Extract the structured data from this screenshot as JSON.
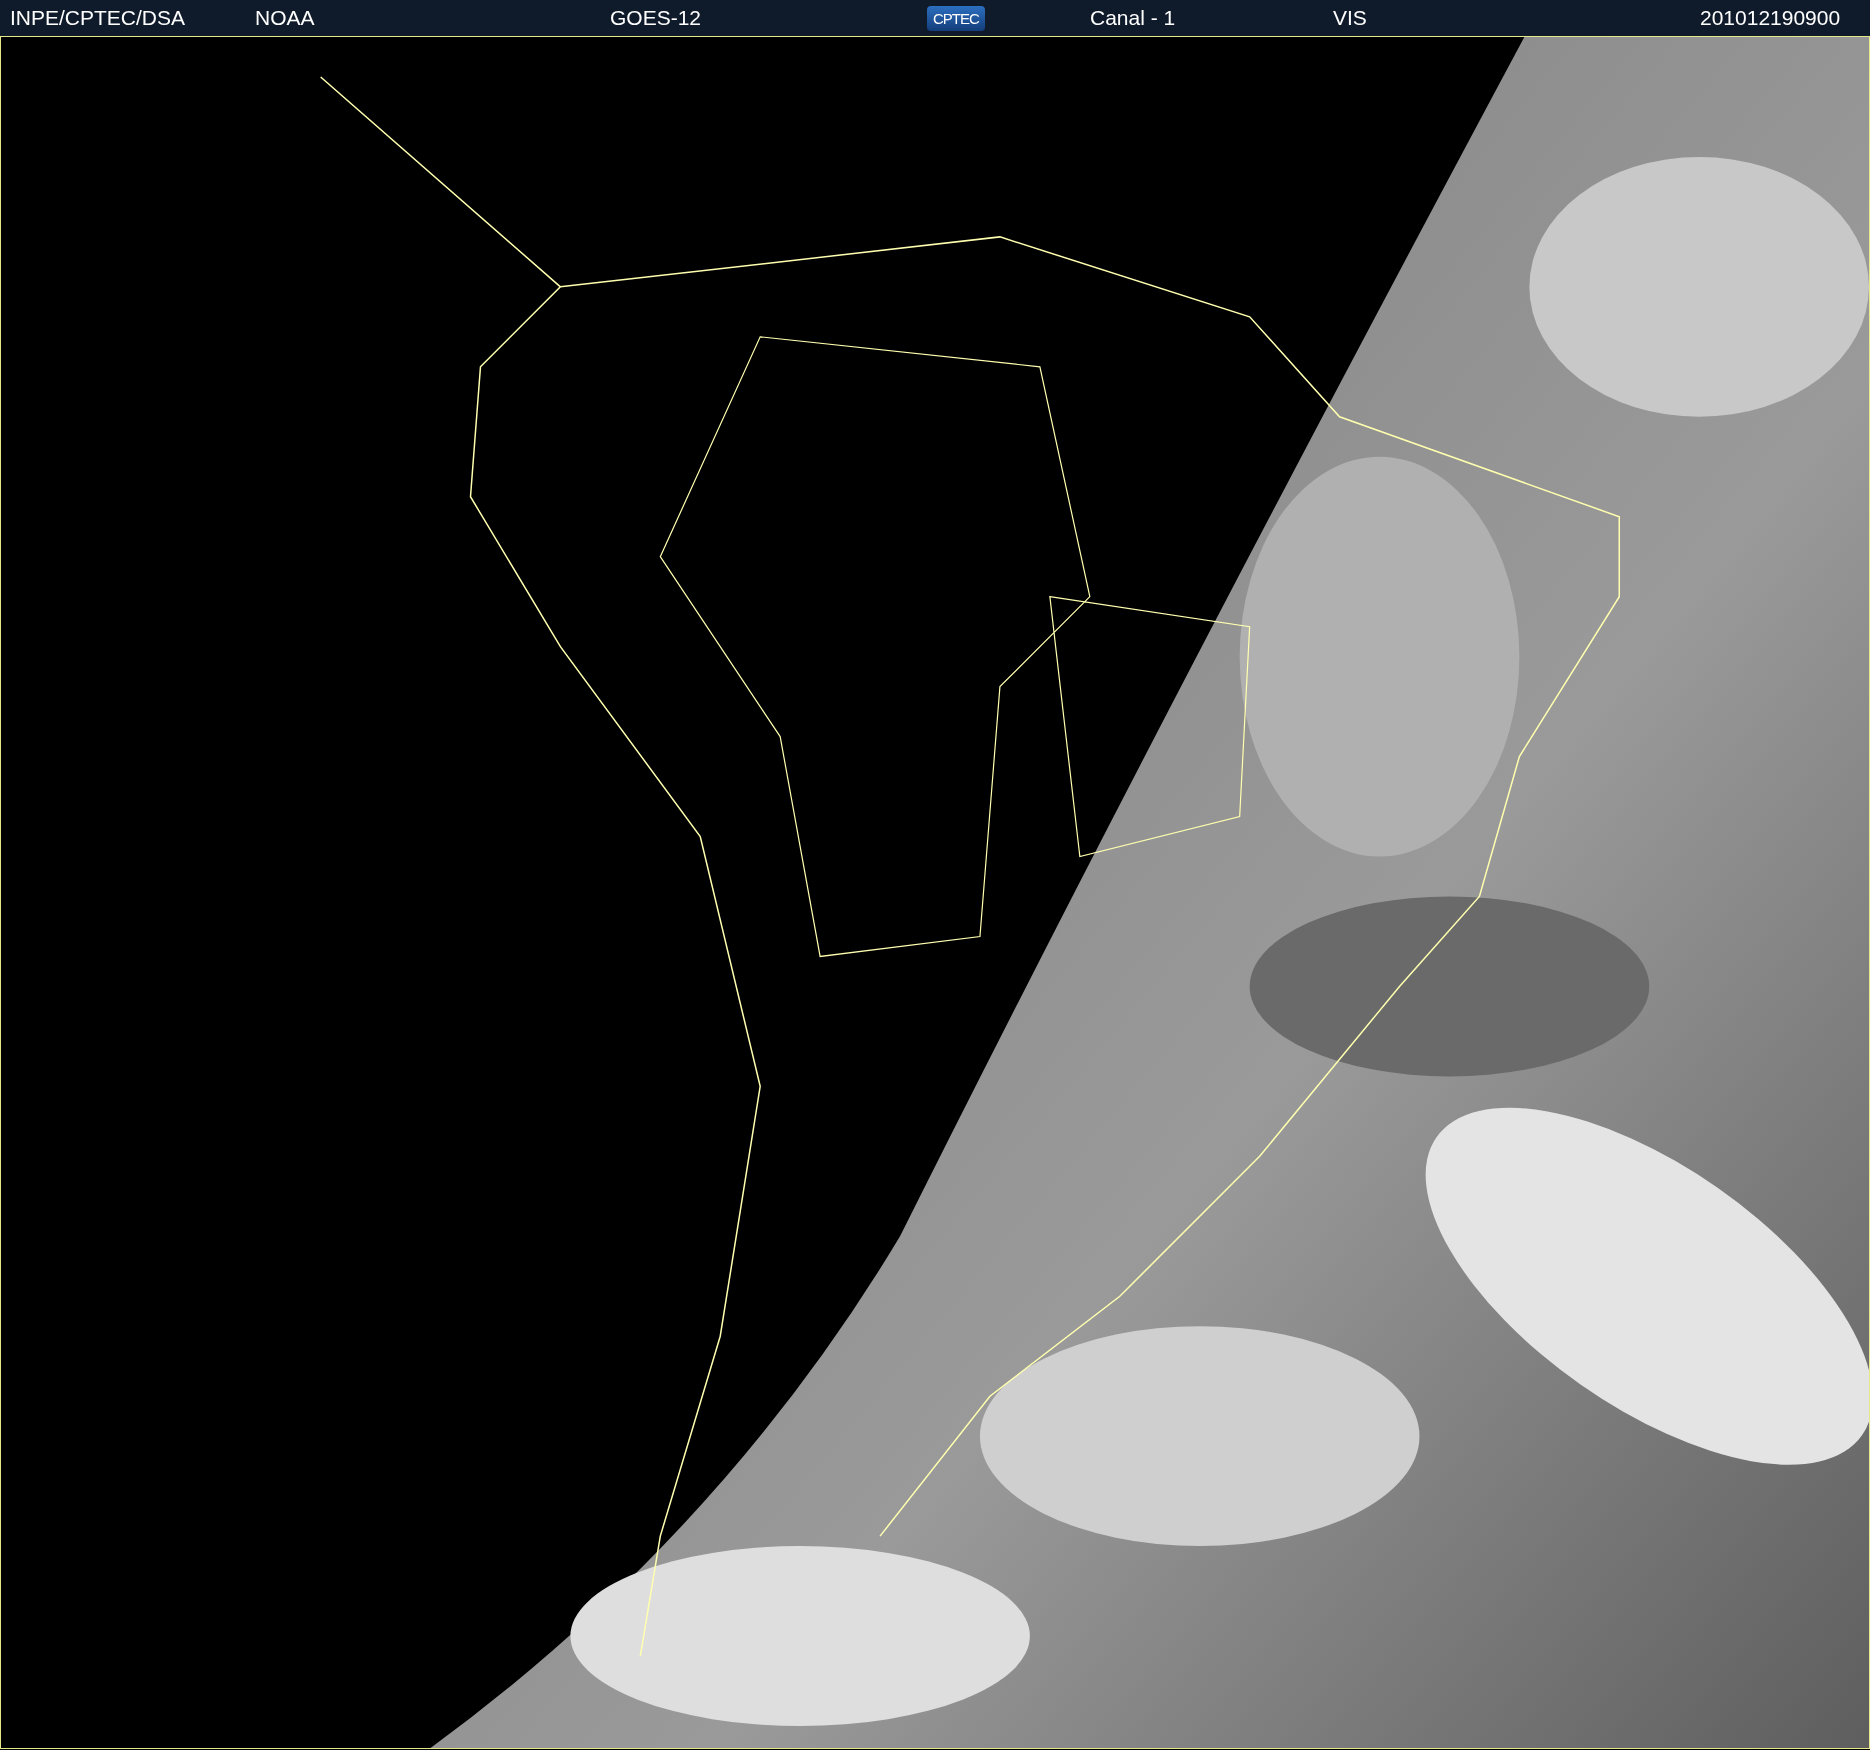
{
  "header": {
    "items": [
      {
        "kind": "text",
        "text": "INPE/CPTEC/DSA"
      },
      {
        "kind": "text",
        "text": "NOAA"
      },
      {
        "kind": "text",
        "text": "GOES-12"
      },
      {
        "kind": "logo",
        "text": "CPTEC"
      },
      {
        "kind": "text",
        "text": "Canal - 1"
      },
      {
        "kind": "text",
        "text": "VIS"
      },
      {
        "kind": "text",
        "text": "201012190900"
      }
    ]
  }
}
